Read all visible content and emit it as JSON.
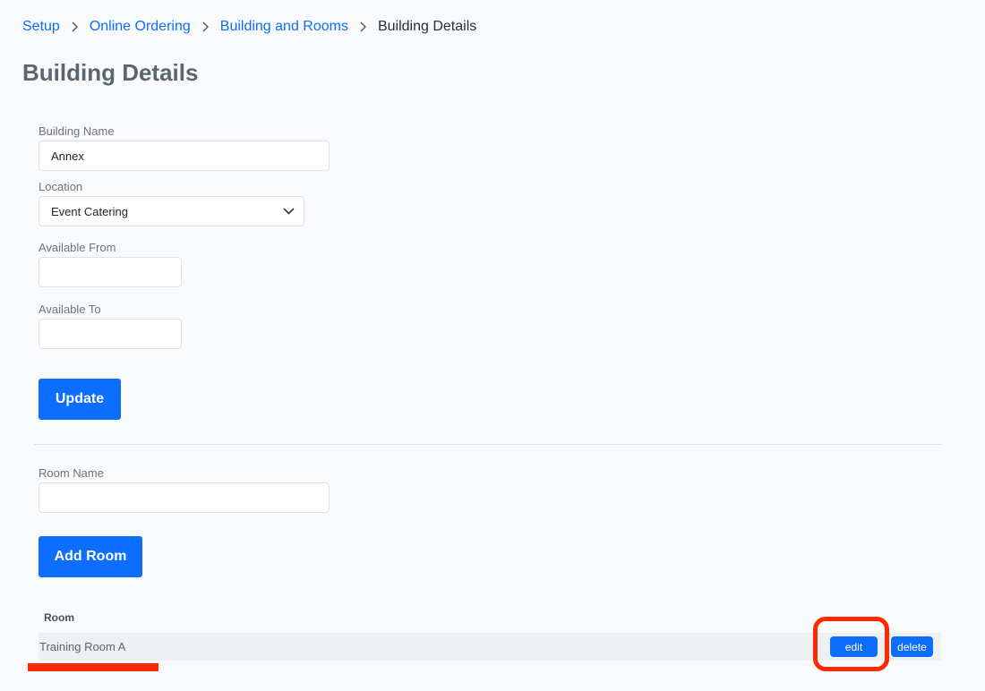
{
  "breadcrumb": {
    "items": [
      "Setup",
      "Online Ordering",
      "Building and Rooms"
    ],
    "current": "Building Details"
  },
  "page": {
    "title": "Building Details"
  },
  "form": {
    "building_name": {
      "label": "Building Name",
      "value": "Annex"
    },
    "location": {
      "label": "Location",
      "value": "Event Catering"
    },
    "available_from": {
      "label": "Available From",
      "value": ""
    },
    "available_to": {
      "label": "Available To",
      "value": ""
    },
    "update_label": "Update"
  },
  "rooms": {
    "room_name": {
      "label": "Room Name",
      "value": ""
    },
    "add_label": "Add Room",
    "table": {
      "header": "Room",
      "rows": [
        {
          "name": "Training Room A",
          "edit_label": "edit",
          "delete_label": "delete"
        }
      ]
    }
  },
  "colors": {
    "accent": "#0d6efd",
    "annotation": "#ff2a00"
  },
  "icons": {
    "separator": "chevron-right-icon",
    "select": "chevron-down-icon"
  }
}
